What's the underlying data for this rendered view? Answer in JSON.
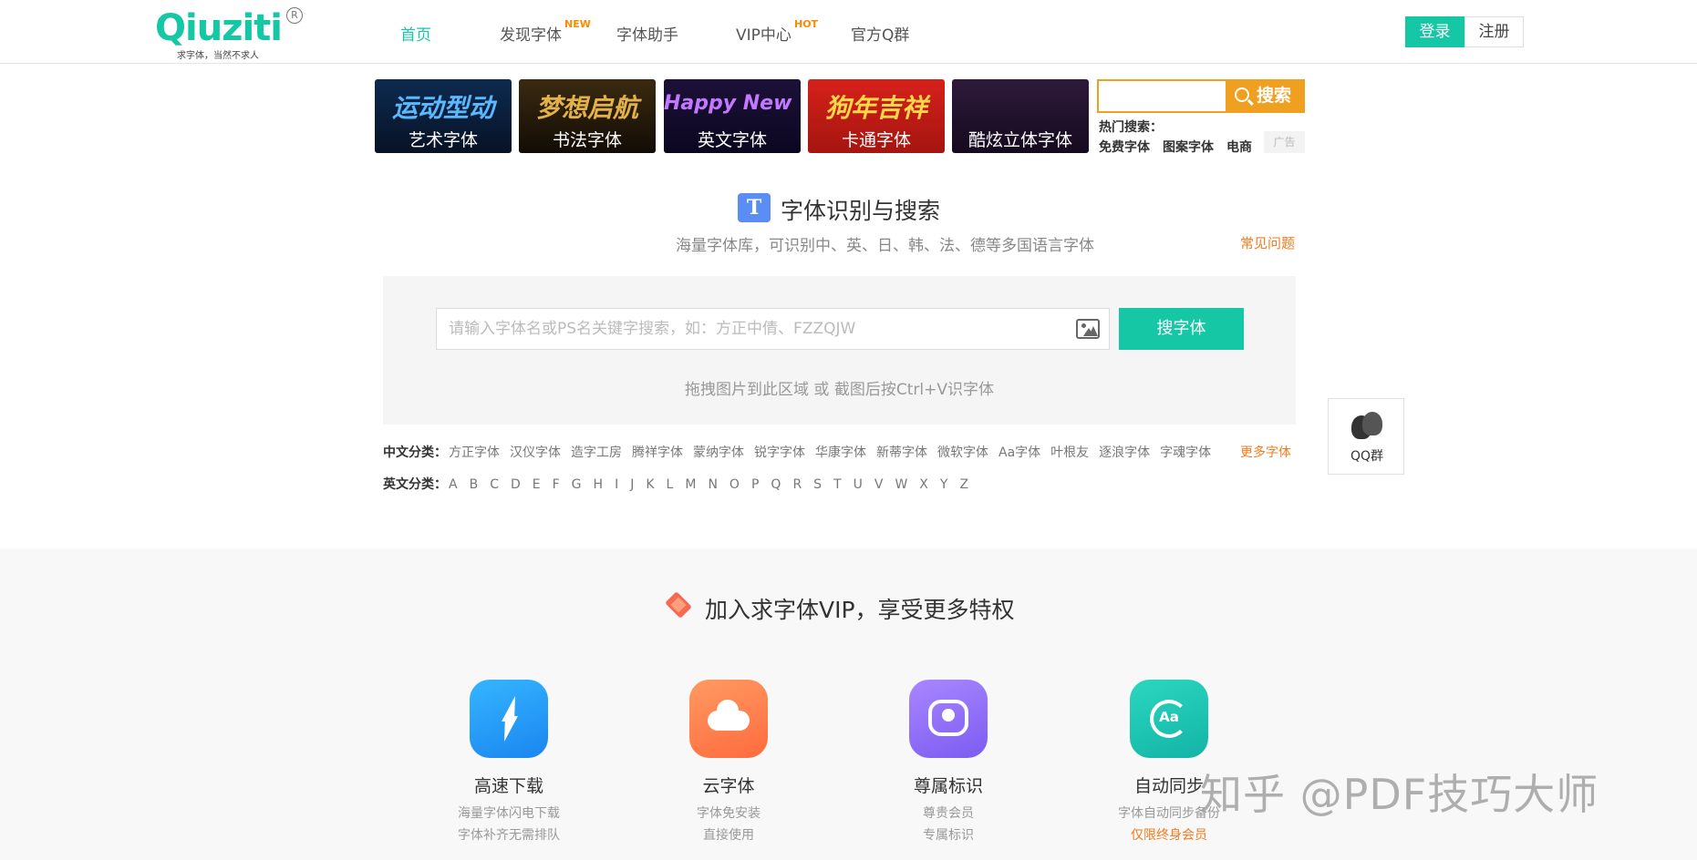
{
  "brand": {
    "logo_text": "Qiuziti",
    "registered_mark": "R",
    "slogan": "求字体，当然不求人"
  },
  "nav": {
    "items": [
      {
        "label": "首页",
        "tag": ""
      },
      {
        "label": "发现字体",
        "tag": "NEW"
      },
      {
        "label": "字体助手",
        "tag": ""
      },
      {
        "label": "VIP中心",
        "tag": "HOT"
      },
      {
        "label": "官方Q群",
        "tag": ""
      }
    ],
    "active": "首页"
  },
  "auth": {
    "login": "登录",
    "register": "注册"
  },
  "banners": [
    {
      "art": "运动型动",
      "caption": "艺术字体"
    },
    {
      "art": "梦想启航",
      "caption": "书法字体"
    },
    {
      "art": "Happy New Year",
      "caption": "英文字体"
    },
    {
      "art": "狗年吉祥",
      "caption": "卡通字体"
    },
    {
      "art": "",
      "caption": "酷炫立体字体"
    }
  ],
  "mini_search": {
    "button": "搜索",
    "hot_label": "热门搜索：",
    "hot_items": [
      "免费字体",
      "图案字体",
      "电商"
    ],
    "ad_tag": "广告"
  },
  "hero": {
    "icon_letter": "T",
    "title": "字体识别与搜索",
    "subtitle": "海量字体库，可识别中、英、日、韩、法、德等多国语言字体",
    "faq": "常见问题"
  },
  "search": {
    "placeholder": "请输入字体名或PS名关键字搜索，如：方正中倩、FZZQJW",
    "value": "",
    "button": "搜字体",
    "drag_hint": "拖拽图片到此区域 或 截图后按Ctrl+V识字体"
  },
  "categories": {
    "cn_label": "中文分类：",
    "cn_items": [
      "方正字体",
      "汉仪字体",
      "造字工房",
      "腾祥字体",
      "蒙纳字体",
      "锐字字体",
      "华康字体",
      "新蒂字体",
      "微软字体",
      "Aa字体",
      "叶根友",
      "逐浪字体",
      "字魂字体"
    ],
    "more": "更多字体",
    "en_label": "英文分类：",
    "en_items": [
      "A",
      "B",
      "C",
      "D",
      "E",
      "F",
      "G",
      "H",
      "I",
      "J",
      "K",
      "L",
      "M",
      "N",
      "O",
      "P",
      "Q",
      "R",
      "S",
      "T",
      "U",
      "V",
      "W",
      "X",
      "Y",
      "Z"
    ]
  },
  "float_qq": {
    "label": "QQ群"
  },
  "vip": {
    "title": "加入求字体VIP，享受更多特权",
    "features": [
      {
        "name": "高速下载",
        "desc1": "海量字体闪电下载",
        "desc2": "字体补齐无需排队"
      },
      {
        "name": "云字体",
        "desc1": "字体免安装",
        "desc2": "直接使用"
      },
      {
        "name": "尊属标识",
        "desc1": "尊贵会员",
        "desc2": "专属标识"
      },
      {
        "name": "自动同步",
        "desc1": "字体自动同步备份",
        "desc2": "仅限终身会员",
        "icon_text": "Aa"
      }
    ]
  },
  "watermark": "知乎 @PDF技巧大师",
  "colors": {
    "accent": "#16c7a6",
    "orange": "#f07d20",
    "search_orange": "#f0a020"
  }
}
